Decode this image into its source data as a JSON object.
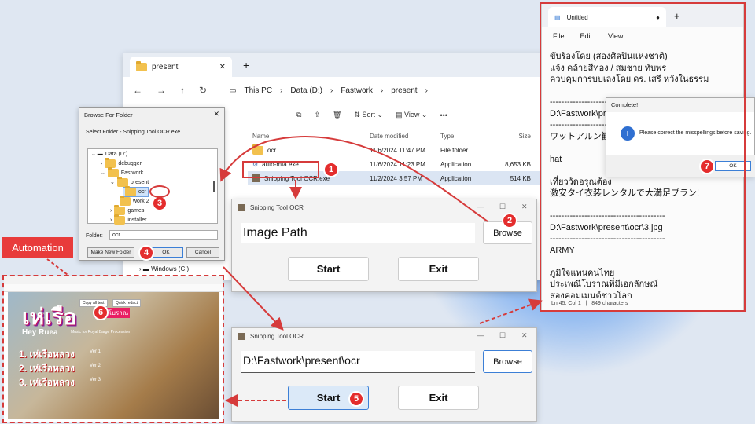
{
  "explorer": {
    "tab": "present",
    "crumbs": [
      "This PC",
      "Data (D:)",
      "Fastwork",
      "present"
    ],
    "toolbar": {
      "sort": "Sort",
      "view": "View",
      "more": "•••"
    },
    "columns": [
      "Name",
      "Date modified",
      "Type",
      "Size"
    ],
    "files": [
      {
        "name": "ocr",
        "date": "11/6/2024 11:47 PM",
        "type": "File folder",
        "size": ""
      },
      {
        "name": "auto-mfa.exe",
        "date": "11/6/2024 11:23 PM",
        "type": "Application",
        "size": "8,653 KB"
      },
      {
        "name": "Snipping Tool OCR.exe",
        "date": "11/2/2024 3:57 PM",
        "type": "Application",
        "size": "514 KB"
      }
    ],
    "side": [
      "N",
      "Windows (C:)"
    ]
  },
  "browse": {
    "title": "Browse For Folder",
    "subtitle": "Select Folder - Snipping Tool OCR.exe",
    "tree": [
      "Data (D:)",
      "debugger",
      "Fastwork",
      "present",
      "ocr",
      "work 2",
      "games",
      "installer"
    ],
    "folder_label": "Folder:",
    "folder_value": "ocr",
    "new_folder": "Make New Folder",
    "ok": "OK",
    "cancel": "Cancel"
  },
  "snip1": {
    "title": "Snipping Tool OCR",
    "path": "Image Path",
    "browse": "Browse",
    "start": "Start",
    "exit": "Exit"
  },
  "snip2": {
    "title": "Snipping Tool OCR",
    "path": "D:\\Fastwork\\present\\ocr",
    "browse": "Browse",
    "start": "Start",
    "exit": "Exit"
  },
  "notepad": {
    "tab": "Untitled",
    "menu": [
      "File",
      "Edit",
      "View"
    ],
    "text": "ขับร้องโดย (สองศิลปินแห่งชาติ)\nแจ้ง คล้ายสีทอง / สมชาย ทับพร\nควบคุมการบบเลงโดย ดร. เสรี หวังในธรรม\n\n----------------------------------------\nD:\\Fastwork\\pr\n----------------------------------------\nワットアルン観光\n\nhat\n\nเที่ยววัดอรุณต้อง\n激安タイ衣装レンタルで大満足プラン!\n\n----------------------------------------\nD:\\Fastwork\\present\\ocr\\3.jpg\n----------------------------------------\nARMY\n\nภูมิใจแทนคนไทย\nประเพณีโบราณที่มีเอกลักษณ์\nส่องคอมเมนต์ชาวโลก",
    "status_pos": "Ln 45, Col 1",
    "status_chars": "849 characters"
  },
  "complete": {
    "title": "Complete!",
    "message": "Please correct the misspellings before saving.",
    "ok": "OK"
  },
  "automation": {
    "label": "Automation",
    "thumb_title": "เห่เรือ",
    "thumb_sub": "ฉบับโบราณ",
    "thumb_eng": "Hey Ruea",
    "thumb_music": "Music for Royal Barge Procession",
    "items": [
      "1. เห่เรือหลวง",
      "2. เห่เรือหลวง",
      "3. เห่เรือหลวง"
    ],
    "vers": [
      "Ver 1",
      "Ver 2",
      "Ver 3"
    ],
    "copy": "Copy all text",
    "quick": "Quick redact"
  },
  "steps": [
    "1",
    "2",
    "3",
    "4",
    "5",
    "6",
    "7"
  ],
  "colors": {
    "accent": "#e42d2d",
    "box": "#d63b3b"
  }
}
